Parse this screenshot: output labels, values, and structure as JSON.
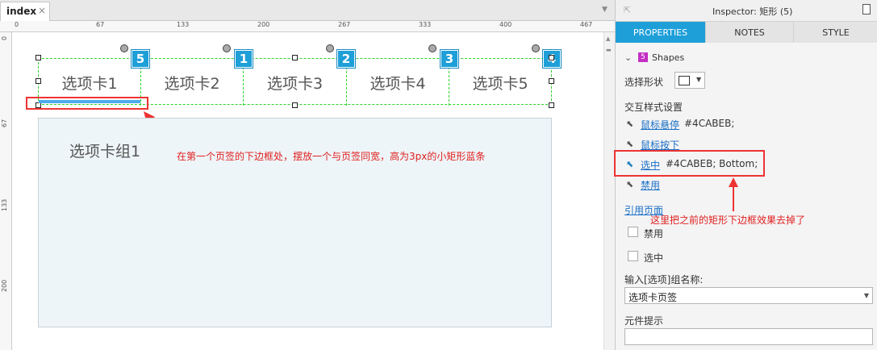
{
  "document_tab": {
    "label": "index",
    "close_glyph": "×"
  },
  "tab_menu_glyph": "▼",
  "ruler": {
    "top_ticks": [
      "0",
      "67",
      "133",
      "200",
      "267",
      "333",
      "400",
      "467"
    ],
    "left_ticks": [
      "0",
      "67",
      "133",
      "200"
    ]
  },
  "canvas": {
    "tabs": [
      {
        "label": "选项卡1",
        "badge": "5"
      },
      {
        "label": "选项卡2",
        "badge": "1"
      },
      {
        "label": "选项卡3",
        "badge": "2"
      },
      {
        "label": "选项卡4",
        "badge": "3"
      },
      {
        "label": "选项卡5",
        "badge": "4"
      }
    ],
    "group_label": "选项卡组1",
    "annotation": "在第一个页签的下边框处，摆放一个与页签同宽，高为3px的小矩形蓝条",
    "accent_color": "#4CABEB"
  },
  "inspector": {
    "title": "Inspector: 矩形 (5)",
    "tabs": [
      "PROPERTIES",
      "NOTES",
      "STYLE"
    ],
    "shapes_section": {
      "count": "5",
      "label": "Shapes"
    },
    "select_shape_label": "选择形状",
    "interaction_styles_label": "交互样式设置",
    "styles": [
      {
        "name": "鼠标悬停",
        "value": "#4CABEB;"
      },
      {
        "name": "鼠标按下",
        "value": ""
      },
      {
        "name": "选中",
        "value": "#4CABEB; Bottom;"
      },
      {
        "name": "禁用",
        "value": ""
      }
    ],
    "reference_page_link": "引用页面",
    "checkbox_disabled": "禁用",
    "checkbox_selected": "选中",
    "group_name_label": "输入[选项]组名称:",
    "group_name_value": "选项卡页签",
    "tooltip_label": "元件提示",
    "tooltip_value": "",
    "annotation": "这里把之前的矩形下边框效果去掉了"
  }
}
